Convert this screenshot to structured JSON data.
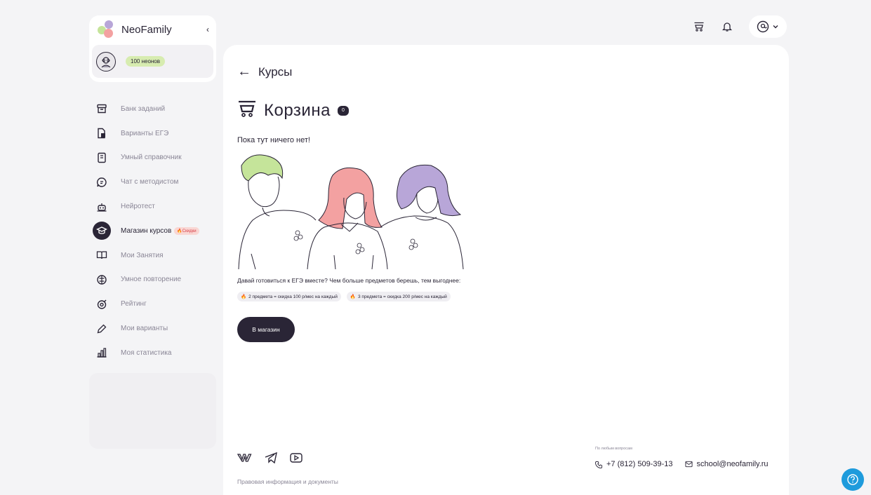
{
  "brand": {
    "name": "NeoFamily",
    "collapse_icon": "chevron-left-icon"
  },
  "user": {
    "neon_balance": "100 неонов"
  },
  "nav": {
    "items": [
      {
        "label": "Банк заданий",
        "icon": "archive-icon"
      },
      {
        "label": "Варианты ЕГЭ",
        "icon": "documents-icon"
      },
      {
        "label": "Умный справочник",
        "icon": "book-icon"
      },
      {
        "label": "Чат с методистом",
        "icon": "chat-icon"
      },
      {
        "label": "Нейротест",
        "icon": "robot-icon"
      },
      {
        "label": "Магазин курсов",
        "icon": "graduation-cap-icon",
        "active": true,
        "badge": "Скидки"
      },
      {
        "label": "Мои Занятия",
        "icon": "open-book-icon"
      },
      {
        "label": "Умное повторение",
        "icon": "brain-icon"
      },
      {
        "label": "Рейтинг",
        "icon": "target-icon"
      },
      {
        "label": "Мои варианты",
        "icon": "pencil-icon"
      },
      {
        "label": "Моя статистика",
        "icon": "bar-chart-icon"
      }
    ]
  },
  "main": {
    "back_label": "Курсы",
    "title": "Корзина",
    "cart_count": "0",
    "empty_text": "Пока тут ничего нет!",
    "promo_text": "Давай готовиться к ЕГЭ вместе? Чем больше предметов берешь, тем выгоднее:",
    "chips": [
      "2 предмета = скидка 100 р/мес на каждый",
      "3 предмета = скидка 200 р/мес на каждый"
    ],
    "shop_button": "В магазин"
  },
  "footer": {
    "legal": "Правовая информация и документы",
    "contact_caption": "По любым вопросам",
    "phone": "+7 (812) 509-39-13",
    "email": "school@neofamily.ru"
  },
  "colors": {
    "dark": "#2a2536",
    "accent_green": "#c5e49a",
    "accent_pink": "#f3a1a1",
    "accent_purple": "#b8a6d8",
    "help_blue": "#1e9bdc"
  }
}
